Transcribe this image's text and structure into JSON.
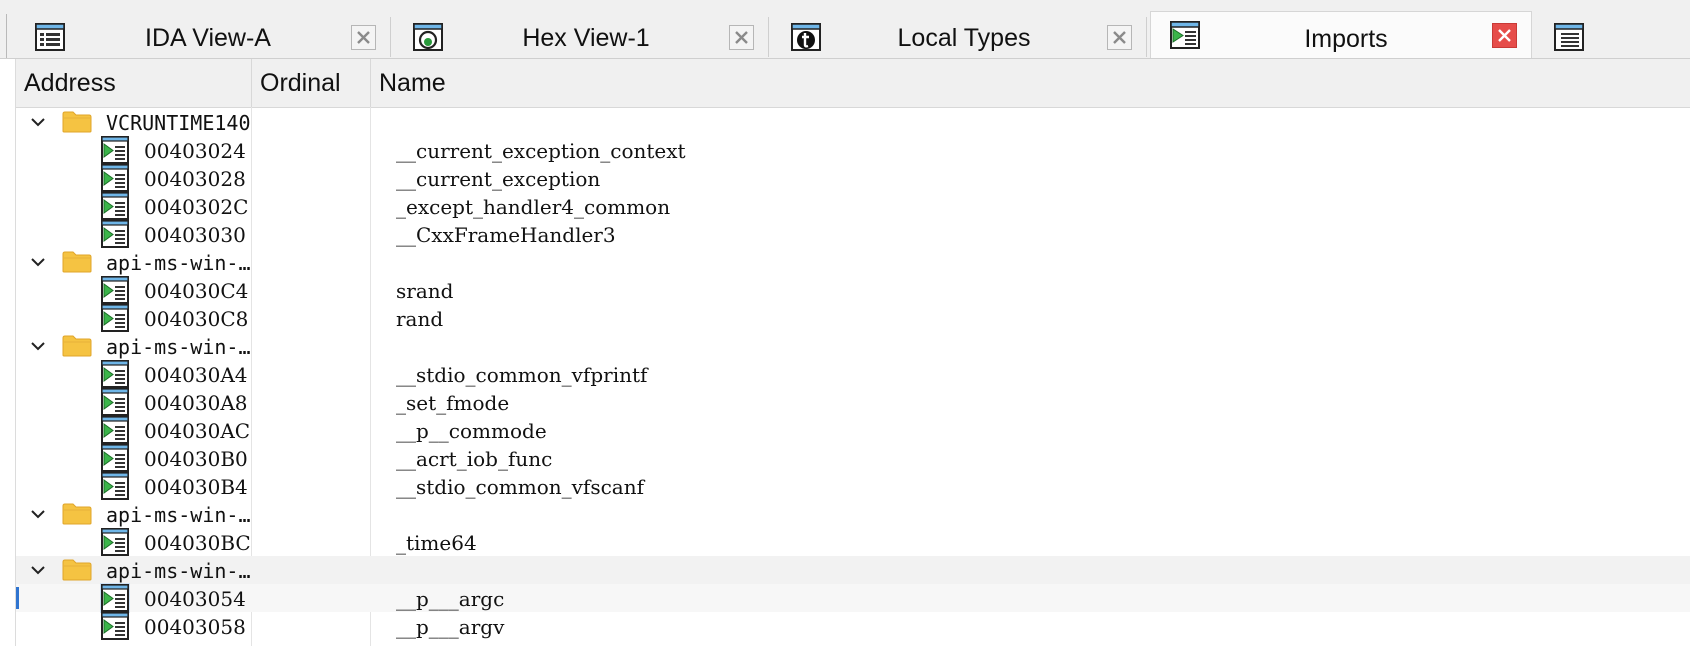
{
  "tabs": [
    {
      "label": "IDA View-A",
      "icon": "ida-view-icon",
      "active": false
    },
    {
      "label": "Hex View-1",
      "icon": "hex-view-icon",
      "active": false
    },
    {
      "label": "Local Types",
      "icon": "local-types-icon",
      "active": false
    },
    {
      "label": "Imports",
      "icon": "imports-icon",
      "active": true
    }
  ],
  "columns": {
    "address": "Address",
    "ordinal": "Ordinal",
    "name": "Name"
  },
  "colors": {
    "close_active": "#e64d4a",
    "folder": "#f5c342",
    "selection_marker": "#2f74d0"
  },
  "groups": [
    {
      "name": "VCRUNTIME140",
      "items": [
        {
          "address": "00403024",
          "ordinal": "",
          "name": "__current_exception_context"
        },
        {
          "address": "00403028",
          "ordinal": "",
          "name": "__current_exception"
        },
        {
          "address": "0040302C",
          "ordinal": "",
          "name": "_except_handler4_common"
        },
        {
          "address": "00403030",
          "ordinal": "",
          "name": "__CxxFrameHandler3"
        }
      ]
    },
    {
      "name": "api-ms-win-…",
      "items": [
        {
          "address": "004030C4",
          "ordinal": "",
          "name": "srand"
        },
        {
          "address": "004030C8",
          "ordinal": "",
          "name": "rand"
        }
      ]
    },
    {
      "name": "api-ms-win-…",
      "items": [
        {
          "address": "004030A4",
          "ordinal": "",
          "name": "__stdio_common_vfprintf"
        },
        {
          "address": "004030A8",
          "ordinal": "",
          "name": "_set_fmode"
        },
        {
          "address": "004030AC",
          "ordinal": "",
          "name": "__p__commode"
        },
        {
          "address": "004030B0",
          "ordinal": "",
          "name": "__acrt_iob_func"
        },
        {
          "address": "004030B4",
          "ordinal": "",
          "name": "__stdio_common_vfscanf"
        }
      ]
    },
    {
      "name": "api-ms-win-…",
      "items": [
        {
          "address": "004030BC",
          "ordinal": "",
          "name": "_time64"
        }
      ]
    },
    {
      "name": "api-ms-win-…",
      "highlighted": true,
      "items": [
        {
          "address": "00403054",
          "ordinal": "",
          "name": "__p___argc",
          "selected": true
        },
        {
          "address": "00403058",
          "ordinal": "",
          "name": "__p___argv"
        }
      ]
    }
  ]
}
